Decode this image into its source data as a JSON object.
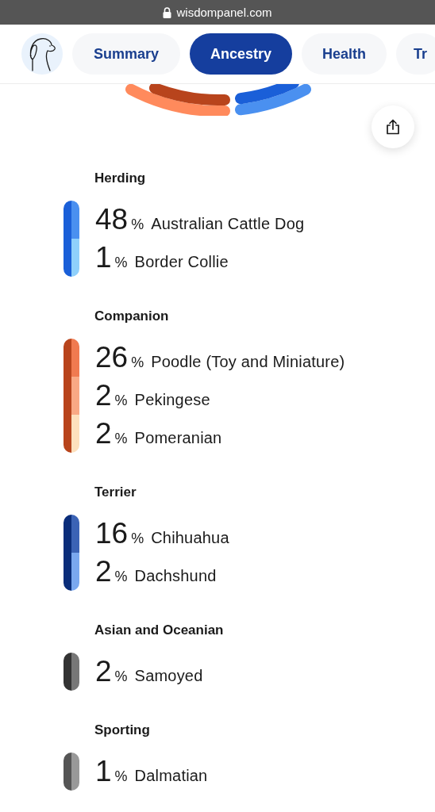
{
  "address_bar": {
    "url": "wisdompanel.com"
  },
  "tabs": [
    {
      "label": "Summary",
      "selected": false
    },
    {
      "label": "Ancestry",
      "selected": true
    },
    {
      "label": "Health",
      "selected": false
    },
    {
      "label": "Tr",
      "selected": false
    }
  ],
  "groups": [
    {
      "title": "Herding",
      "color": "#1a5fd8",
      "breeds": [
        {
          "percent": "48",
          "unit": "%",
          "name": "Australian Cattle Dog",
          "color": "#4a90f0"
        },
        {
          "percent": "1",
          "unit": "%",
          "name": "Border Collie",
          "color": "#8fd0fb"
        }
      ]
    },
    {
      "title": "Companion",
      "color": "#b8441c",
      "breeds": [
        {
          "percent": "26",
          "unit": "%",
          "name": "Poodle (Toy and Miniature)",
          "color": "#f07a50"
        },
        {
          "percent": "2",
          "unit": "%",
          "name": "Pekingese",
          "color": "#f9a985"
        },
        {
          "percent": "2",
          "unit": "%",
          "name": "Pomeranian",
          "color": "#fde0bd"
        }
      ]
    },
    {
      "title": "Terrier",
      "color": "#0a2d7a",
      "breeds": [
        {
          "percent": "16",
          "unit": "%",
          "name": "Chihuahua",
          "color": "#3b63b5"
        },
        {
          "percent": "2",
          "unit": "%",
          "name": "Dachshund",
          "color": "#7aa8ef"
        }
      ]
    },
    {
      "title": "Asian and Oceanian",
      "color": "#333333",
      "breeds": [
        {
          "percent": "2",
          "unit": "%",
          "name": "Samoyed",
          "color": "#777777"
        }
      ]
    },
    {
      "title": "Sporting",
      "color": "#555555",
      "breeds": [
        {
          "percent": "1",
          "unit": "%",
          "name": "Dalmatian",
          "color": "#999999"
        }
      ]
    }
  ]
}
